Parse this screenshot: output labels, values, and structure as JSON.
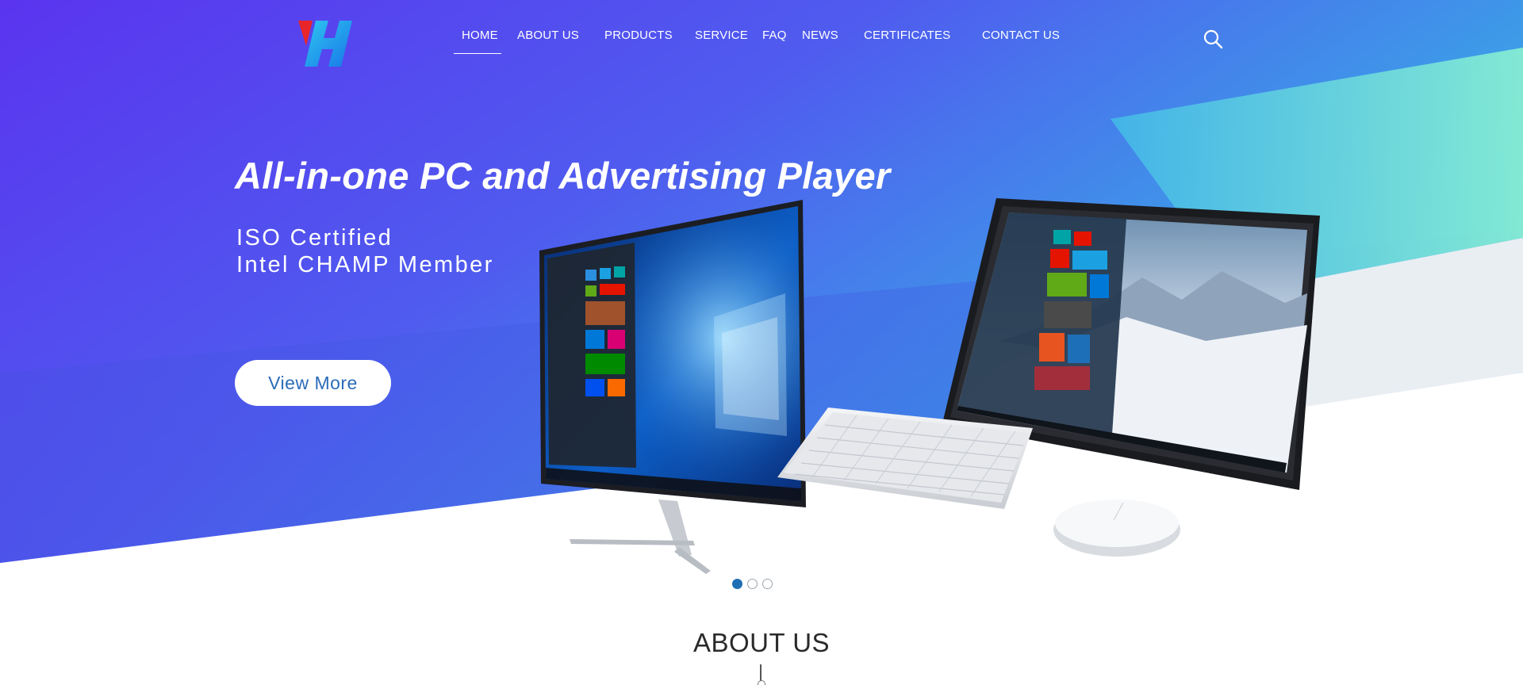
{
  "header": {
    "nav": [
      {
        "label": "HOME",
        "active": true
      },
      {
        "label": "ABOUT US"
      },
      {
        "label": "PRODUCTS"
      },
      {
        "label": "SERVICE"
      },
      {
        "label": "FAQ"
      },
      {
        "label": "NEWS"
      },
      {
        "label": "CERTIFICATES"
      },
      {
        "label": "CONTACT US"
      }
    ],
    "search_icon": "search-icon",
    "logo_icon": "brand-logo"
  },
  "hero": {
    "title": "All-in-one PC and Advertising Player",
    "subtitle_line1": "ISO Certified",
    "subtitle_line2": "Intel CHAMP Member",
    "cta_label": "View More",
    "slides": [
      {
        "active": true
      },
      {
        "active": false
      },
      {
        "active": false
      }
    ]
  },
  "about": {
    "title": "ABOUT US"
  },
  "colors": {
    "hero_purple": "#5b3bef",
    "hero_blue": "#3f7fe8",
    "hero_cyan": "#39b7ea",
    "accent_teal": "#7ee8d6",
    "cta_text": "#2b6cb8",
    "dot_active": "#1f6fb5"
  }
}
